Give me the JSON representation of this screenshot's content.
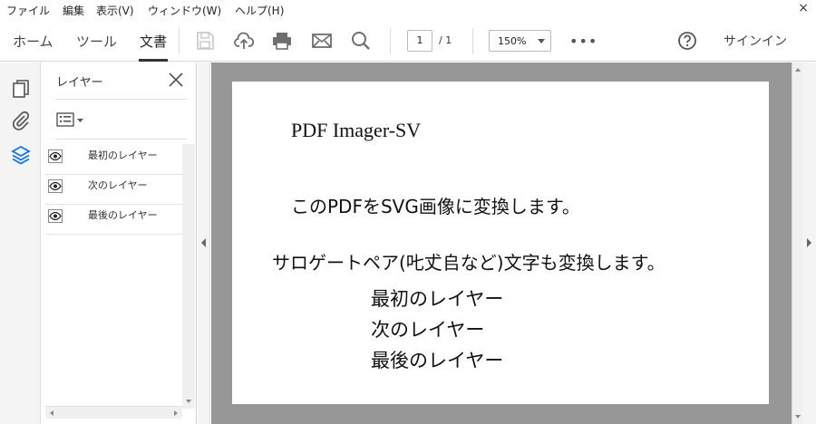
{
  "menu": {
    "items": [
      "ファイル",
      "編集",
      "表示(V)",
      "ウィンドウ(W)",
      "ヘルプ(H)"
    ],
    "close_glyph": "×"
  },
  "toolbar": {
    "tabs": [
      "ホーム",
      "ツール",
      "文書"
    ],
    "active_tab": "文書",
    "icons": [
      "save-icon",
      "cloud-upload-icon",
      "print-icon",
      "email-icon",
      "search-icon"
    ],
    "page_current": "1",
    "page_total": "/ 1",
    "zoom": "150%",
    "more": "•••",
    "help_icon": "help-icon",
    "signin": "サインイン"
  },
  "rail": {
    "icons": [
      "pages-icon",
      "attachment-icon",
      "layers-icon"
    ],
    "active": "layers-icon"
  },
  "layers_panel": {
    "title": "レイヤー",
    "layers": [
      {
        "label": "最初のレイヤー",
        "visible": true
      },
      {
        "label": "次のレイヤー",
        "visible": true
      },
      {
        "label": "最後のレイヤー",
        "visible": true
      }
    ]
  },
  "document": {
    "title": "PDF Imager-SV",
    "line1": "このPDFをSVG画像に変換します。",
    "line2": "サロゲートペア(𠮟𠀋𠂤など)文字も変換します。",
    "layer1": "最初のレイヤー",
    "layer2": "次のレイヤー",
    "layer3": "最後のレイヤー"
  },
  "colors": {
    "accent": "#1473e6",
    "doc_background": "#979797",
    "toolbar_icon": "#6e6e6e"
  }
}
